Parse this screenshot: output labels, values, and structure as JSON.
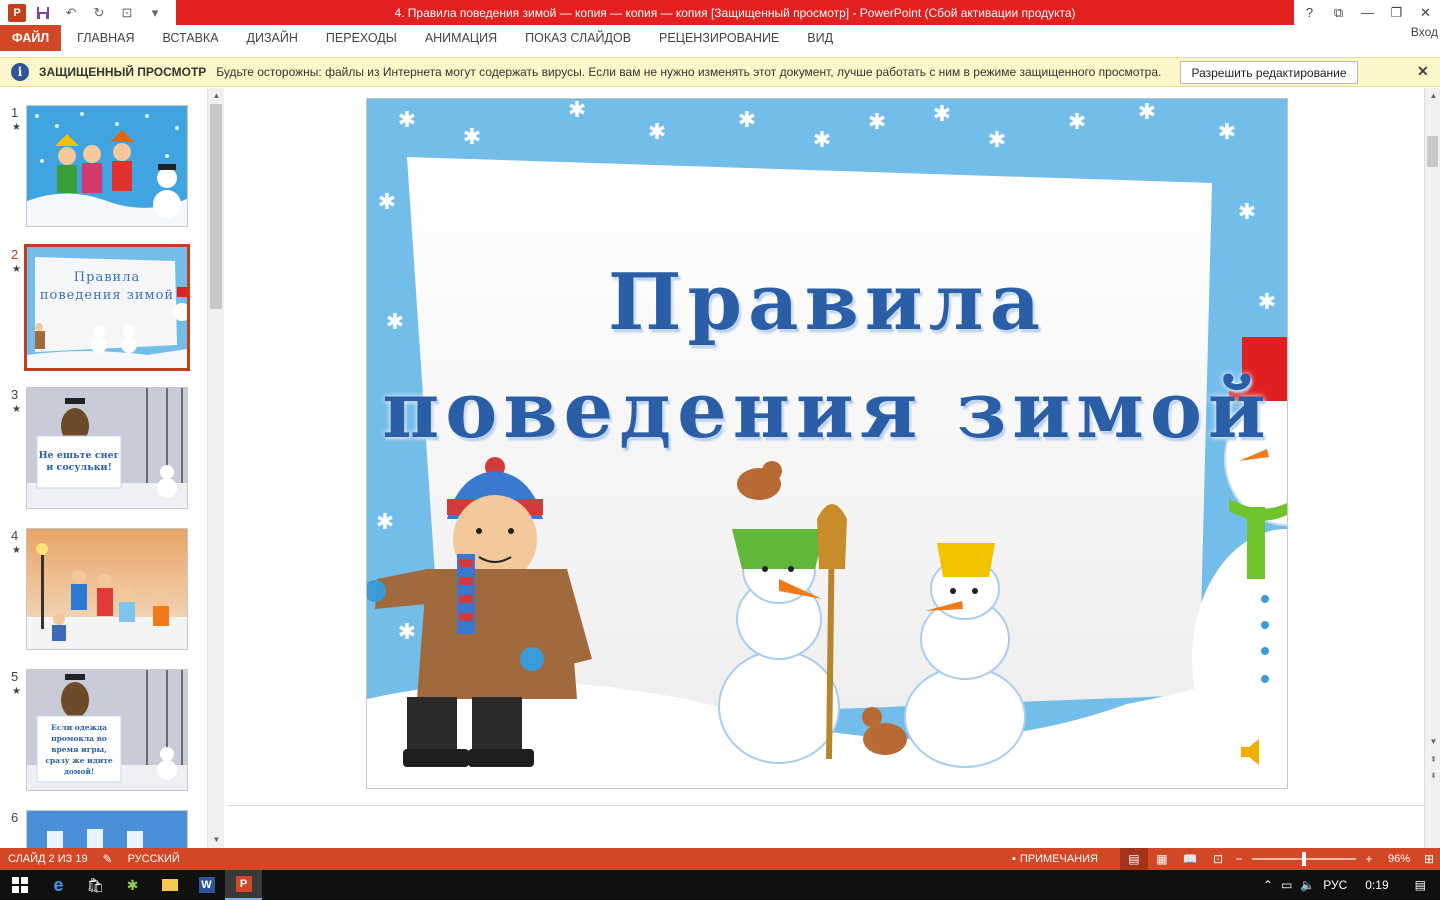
{
  "titlebar": {
    "app_icon": "P",
    "title": "4. Правила поведения зимой — копия — копия — копия [Защищенный просмотр] -  PowerPoint (Сбой активации продукта)",
    "help": "?",
    "ribbon_options": "⧉",
    "minimize": "—",
    "restore": "❐",
    "close": "✕"
  },
  "ribbon": {
    "tabs": [
      "ФАЙЛ",
      "ГЛАВНАЯ",
      "ВСТАВКА",
      "ДИЗАЙН",
      "ПЕРЕХОДЫ",
      "АНИМАЦИЯ",
      "ПОКАЗ СЛАЙДОВ",
      "РЕЦЕНЗИРОВАНИЕ",
      "ВИД"
    ],
    "login": "Вход"
  },
  "protected_view": {
    "title": "ЗАЩИЩЕННЫЙ ПРОСМОТР",
    "message": "Будьте осторожны: файлы из Интернета могут содержать вирусы. Если вам не нужно изменять этот документ, лучше работать с ним в режиме защищенного просмотра.",
    "enable_button": "Разрешить редактирование",
    "close": "✕"
  },
  "thumbnails": [
    {
      "number": "1",
      "star": "★"
    },
    {
      "number": "2",
      "star": "★",
      "title_line1": "Правила",
      "title_line2": "поведения зимой"
    },
    {
      "number": "3",
      "star": "★",
      "caption": "Не ешьте снег и сосульки!"
    },
    {
      "number": "4",
      "star": "★"
    },
    {
      "number": "5",
      "star": "★",
      "caption": "Если одежда промокла во время игры, сразу же идите домой!"
    },
    {
      "number": "6",
      "star": ""
    }
  ],
  "slide": {
    "title_line1": "Правила",
    "title_line2": "поведения зимой"
  },
  "status": {
    "slide_info": "СЛАЙД 2 ИЗ 19",
    "language": "РУССКИЙ",
    "notes": "ПРИМЕЧАНИЯ",
    "zoom_minus": "−",
    "zoom_plus": "+",
    "zoom": "96%",
    "zoom_level_fraction": 0.5
  },
  "taskbar": {
    "tray_lang": "РУС",
    "time": "0:19"
  },
  "colors": {
    "accent": "#d24726",
    "title_red": "#e32020",
    "protected_bg": "#fdf6c8",
    "slide_blue": "#73bdeb",
    "title_text": "#2a5fa8"
  }
}
